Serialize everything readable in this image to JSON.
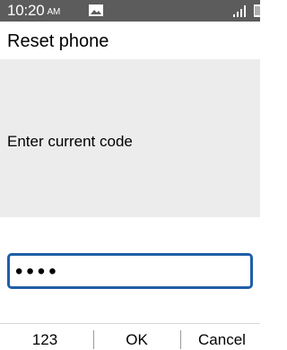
{
  "status_bar": {
    "time": "10:20",
    "ampm": "AM",
    "notification_icon": "image-icon",
    "signal_icon": "signal-icon",
    "battery_icon": "battery-icon"
  },
  "header": {
    "title": "Reset phone"
  },
  "message": {
    "text": "Enter current code"
  },
  "input": {
    "masked_value": "••••",
    "accent_color": "#1f5fa8"
  },
  "softkeys": {
    "left": "123",
    "center": "OK",
    "right": "Cancel"
  },
  "colors": {
    "status_bar_bg": "#5c5c5c",
    "message_bg": "#ececec"
  }
}
